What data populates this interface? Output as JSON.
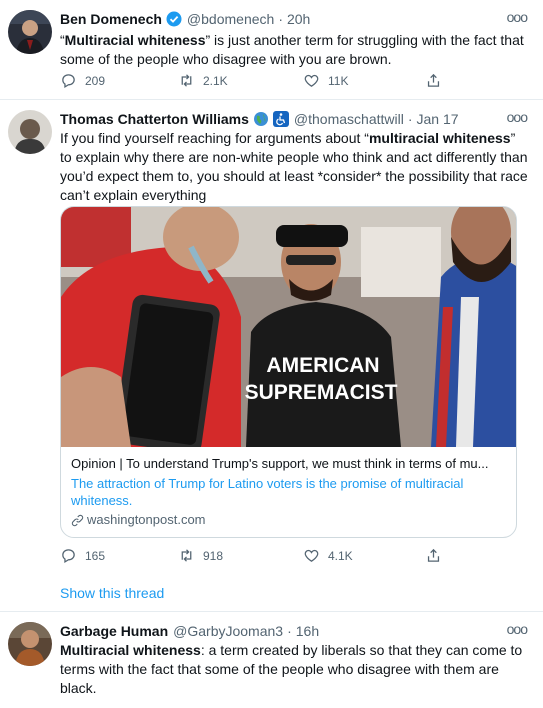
{
  "tweets": [
    {
      "name": "Ben Domenech",
      "handle": "@bdomenech",
      "time": "20h",
      "text_bold": "Multiracial whiteness",
      "text_open_quote": "“",
      "text_close_quote": "”",
      "text_rest": " is just another term for struggling with the fact that some of the people who disagree with you are brown.",
      "replies": "209",
      "retweets": "2.1K",
      "likes": "11K"
    },
    {
      "name": "Thomas Chatterton Williams",
      "handle": "@thomaschattwill",
      "time": "Jan 17",
      "text_pre": "If you find yourself reaching for arguments about “",
      "text_bold": "multiracial whiteness",
      "text_post": "” to explain why there are non-white people who think and act differently than you’d expect them to, you should at least *consider* the possibility that race can’t explain everything",
      "card": {
        "image_shirt_line1": "AMERICAN",
        "image_shirt_line2": "SUPREMACIST",
        "title": "Opinion | To understand Trump's support, we must think in terms of mu...",
        "description": "The attraction of Trump for Latino voters is the promise of multiracial whiteness.",
        "domain": "washingtonpost.com"
      },
      "replies": "165",
      "retweets": "918",
      "likes": "4.1K",
      "show_thread": "Show this thread"
    },
    {
      "name": "Garbage Human",
      "handle": "@GarbyJooman3",
      "time": "16h",
      "text_bold": "Multiracial whiteness",
      "text_rest": ": a term created by liberals so that they can come to terms with the fact that some of the people who disagree with them are black."
    }
  ],
  "separator": "·",
  "more_label": "ooo",
  "colors": {
    "accent": "#1d9bf0",
    "muted": "#536471",
    "border": "#e6ecf0"
  }
}
